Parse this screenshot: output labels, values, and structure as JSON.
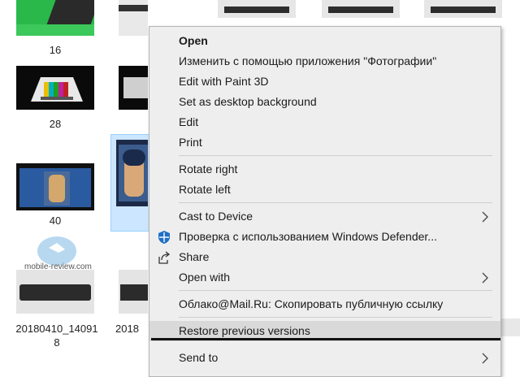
{
  "explorer": {
    "labels": {
      "l16": "16",
      "l28": "28",
      "l40": "40",
      "f1_line1": "20180410_14091",
      "f1_line2": "8",
      "f2": "2018"
    },
    "watermark": "mobile-review.com"
  },
  "context_menu": {
    "items": [
      {
        "label": "Open",
        "icon": "",
        "submenu": false
      },
      {
        "label": "Изменить с помощью приложения \"Фотографии\"",
        "icon": "",
        "submenu": false
      },
      {
        "label": "Edit with Paint 3D",
        "icon": "",
        "submenu": false
      },
      {
        "label": "Set as desktop background",
        "icon": "",
        "submenu": false
      },
      {
        "label": "Edit",
        "icon": "",
        "submenu": false
      },
      {
        "label": "Print",
        "icon": "",
        "submenu": false
      },
      {
        "label": "Rotate right",
        "icon": "",
        "submenu": false
      },
      {
        "label": "Rotate left",
        "icon": "",
        "submenu": false
      },
      {
        "label": "Cast to Device",
        "icon": "",
        "submenu": true
      },
      {
        "label": "Проверка с использованием Windows Defender...",
        "icon": "windows-defender-icon",
        "submenu": false
      },
      {
        "label": "Share",
        "icon": "share-icon",
        "submenu": false
      },
      {
        "label": "Open with",
        "icon": "",
        "submenu": true
      },
      {
        "label": "Облако@Mail.Ru: Скопировать публичную ссылку",
        "icon": "",
        "submenu": false
      },
      {
        "label": "Restore previous versions",
        "icon": "",
        "submenu": false,
        "highlighted": true
      },
      {
        "label": "Send to",
        "icon": "",
        "submenu": true
      }
    ]
  },
  "colors": {
    "menu_bg": "#eeeeee",
    "highlight": "#d9d9d9",
    "selection": "#cce6ff",
    "defender_blue": "#1f6fc4"
  }
}
